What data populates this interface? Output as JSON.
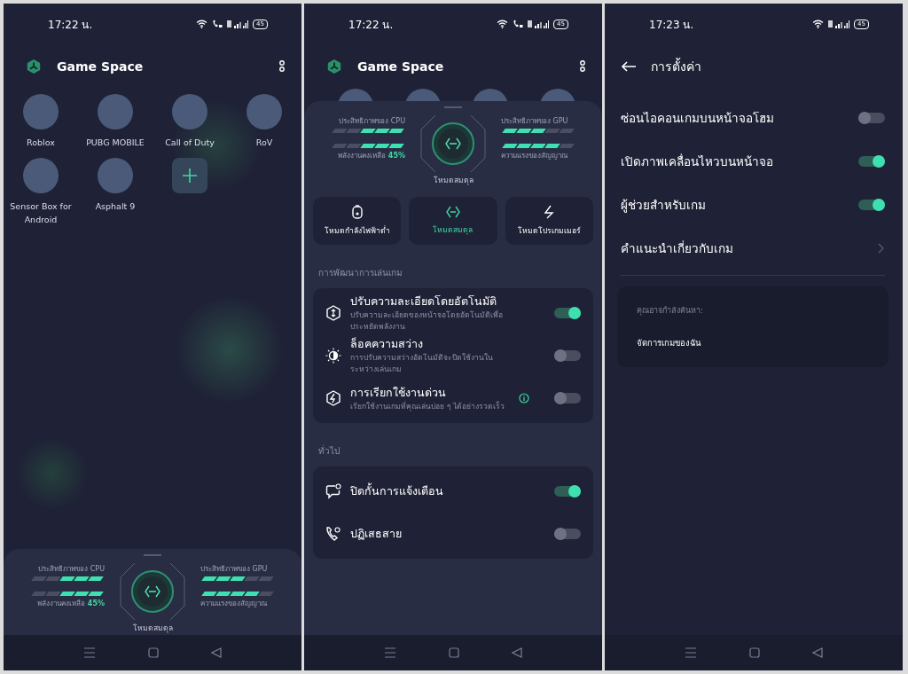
{
  "screens": [
    {
      "kind": "home",
      "status_bar": {
        "time": "17:22 น.",
        "battery": "45",
        "wifi_calling": true
      },
      "header": {
        "title": "Game Space"
      },
      "games": [
        {
          "name": "Roblox"
        },
        {
          "name": "PUBG MOBILE"
        },
        {
          "name": "Call of Duty"
        },
        {
          "name": "RoV"
        },
        {
          "name": "Sensor Box for Android"
        },
        {
          "name": "Asphalt 9"
        }
      ],
      "perf": {
        "meters": [
          {
            "label": "ประสิทธิภาพของ CPU",
            "level": 0.6
          },
          {
            "label": "พลังงานคงเหลือ",
            "value": "45%",
            "level": 0.6
          },
          {
            "label": "ประสิทธิภาพของ GPU",
            "level": 0.6
          },
          {
            "label": "ความแรงของสัญญาณ",
            "level": 0.8
          }
        ],
        "mode_label": "โหมดสมดุล"
      }
    },
    {
      "kind": "boost",
      "status_bar": {
        "time": "17:22 น.",
        "battery": "45",
        "wifi_calling": true
      },
      "header": {
        "title": "Game Space"
      },
      "perf": {
        "meters": [
          {
            "label": "ประสิทธิภาพของ CPU",
            "level": 0.6
          },
          {
            "label": "พลังงานคงเหลือ",
            "value": "45%",
            "level": 0.6
          },
          {
            "label": "ประสิทธิภาพของ GPU",
            "level": 0.6
          },
          {
            "label": "ความแรงของสัญญาณ",
            "level": 0.8
          }
        ],
        "mode_label": "โหมดสมดุล"
      },
      "modes": [
        {
          "kind": "low-power",
          "label": "โหมดกำลังไฟฟ้าต่ำ",
          "selected": false
        },
        {
          "kind": "balanced",
          "label": "โหมดสมดุล",
          "selected": true
        },
        {
          "kind": "pro",
          "label": "โหมดโปรเกมเมอร์",
          "selected": false
        }
      ],
      "sections": [
        {
          "title": "การพัฒนาการเล่นเกม",
          "items": [
            {
              "kind": "resolution",
              "title": "ปรับความละเอียดโดยอัตโนมัติ",
              "description": "ปรับความละเอียดของหน้าจอโดยอัตโนมัติเพื่อประหยัดพลังงาน",
              "info": false,
              "on": true
            },
            {
              "kind": "brightness",
              "title": "ล็อคความสว่าง",
              "description": "การปรับความสว่างอัตโนมัติจะปิดใช้งานในระหว่างเล่นเกม",
              "info": false,
              "on": false
            },
            {
              "kind": "quick-launch",
              "title": "การเรียกใช้งานด่วน",
              "description": "เรียกใช้งานเกมที่คุณเล่นบ่อย ๆ ได้อย่างรวดเร็ว",
              "info": true,
              "on": false
            }
          ]
        },
        {
          "title": "ทั่วไป",
          "items": [
            {
              "kind": "notifications",
              "title": "ปิดกั้นการแจ้งเตือน",
              "info": false,
              "on": true
            },
            {
              "kind": "calls",
              "title": "ปฏิเสธสาย",
              "info": false,
              "on": false
            }
          ]
        }
      ]
    },
    {
      "kind": "settings",
      "status_bar": {
        "time": "17:23 น.",
        "battery": "45",
        "wifi_calling": false
      },
      "title": "การตั้งค่า",
      "settings": [
        {
          "kind": "toggle",
          "label": "ซ่อนไอคอนเกมบนหน้าจอโฮม",
          "on": false
        },
        {
          "kind": "toggle",
          "label": "เปิดภาพเคลื่อนไหวบนหน้าจอ",
          "on": true
        },
        {
          "kind": "toggle",
          "label": "ผู้ช่วยสำหรับเกม",
          "on": true
        },
        {
          "kind": "link",
          "label": "คำแนะนำเกี่ยวกับเกม"
        }
      ],
      "suggestions": {
        "heading": "คุณอาจกำลังค้นหา:",
        "items": [
          "จัดการเกมของฉัน"
        ]
      }
    }
  ]
}
